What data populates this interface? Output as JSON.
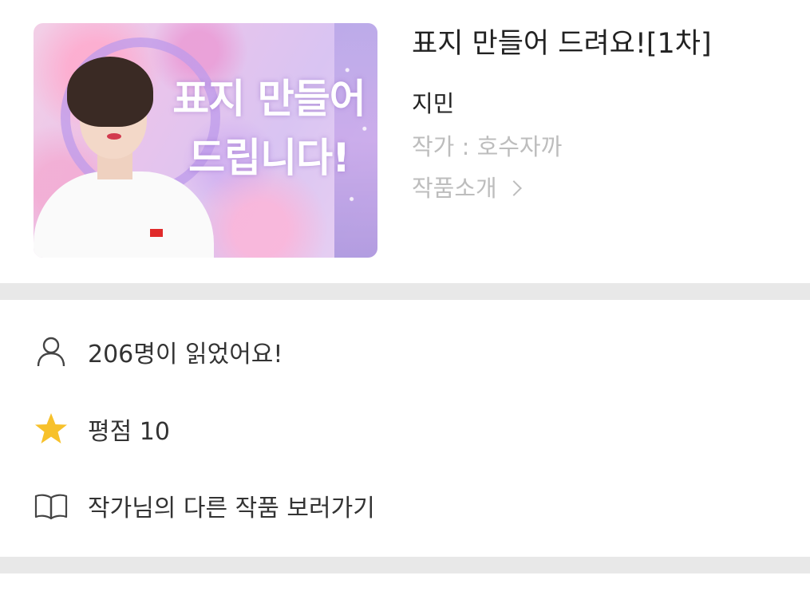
{
  "work": {
    "cover_text_line1": "표지 만들어",
    "cover_text_line2": "드립니다!",
    "title": "표지 만들어 드려요![1차]",
    "subtitle": "지민",
    "author": "작가 : 호수자까",
    "intro_link": "작품소개"
  },
  "stats": {
    "readers": "206명이 읽었어요!",
    "rating": "평점 10",
    "other_works": "작가님의 다른 작품 보러가기"
  },
  "colors": {
    "divider": "#e8e8e8",
    "muted_text": "#bdbdbd",
    "star": "#f7c12b"
  },
  "icons": {
    "readers": "person-outline-icon",
    "rating": "star-icon",
    "other_works": "open-book-icon",
    "intro": "chevron-right-icon"
  }
}
